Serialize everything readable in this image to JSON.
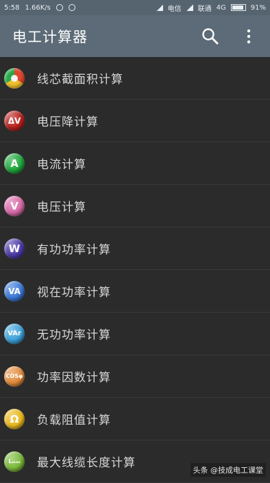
{
  "status": {
    "time": "5:58",
    "speed": "1.66K/s",
    "carrier1": "电信",
    "carrier2": "联通",
    "network": "4G",
    "battery": "91%",
    "battery_level": 0.91
  },
  "appbar": {
    "title": "电工计算器",
    "search_icon": "search-icon",
    "menu_icon": "more-vert-icon"
  },
  "items": [
    {
      "label": "线芯截面积计算",
      "badge": "",
      "color": "#2aa84a",
      "icon": "cross-section-icon"
    },
    {
      "label": "电压降计算",
      "badge": "ΔV",
      "color": "#b8201c",
      "icon": "voltage-drop-icon"
    },
    {
      "label": "电流计算",
      "badge": "A",
      "color": "#1fa83c",
      "icon": "current-icon"
    },
    {
      "label": "电压计算",
      "badge": "V",
      "color": "#d86aa8",
      "icon": "voltage-icon"
    },
    {
      "label": "有功功率计算",
      "badge": "W",
      "color": "#4a3aa8",
      "icon": "active-power-icon"
    },
    {
      "label": "视在功率计算",
      "badge": "VA",
      "color": "#3a78d8",
      "icon": "apparent-power-icon"
    },
    {
      "label": "无功功率计算",
      "badge": "VAr",
      "color": "#3aa0d8",
      "icon": "reactive-power-icon"
    },
    {
      "label": "功率因数计算",
      "badge": "COSφ",
      "color": "#e08a3a",
      "icon": "power-factor-icon"
    },
    {
      "label": "负载阻值计算",
      "badge": "Ω",
      "color": "#e8b81c",
      "icon": "resistance-icon"
    },
    {
      "label": "最大线缆长度计算",
      "badge": "Lₘₐₓ",
      "color": "#7ab83a",
      "icon": "cable-length-icon"
    }
  ],
  "watermark": "头条 @技成电工课堂"
}
